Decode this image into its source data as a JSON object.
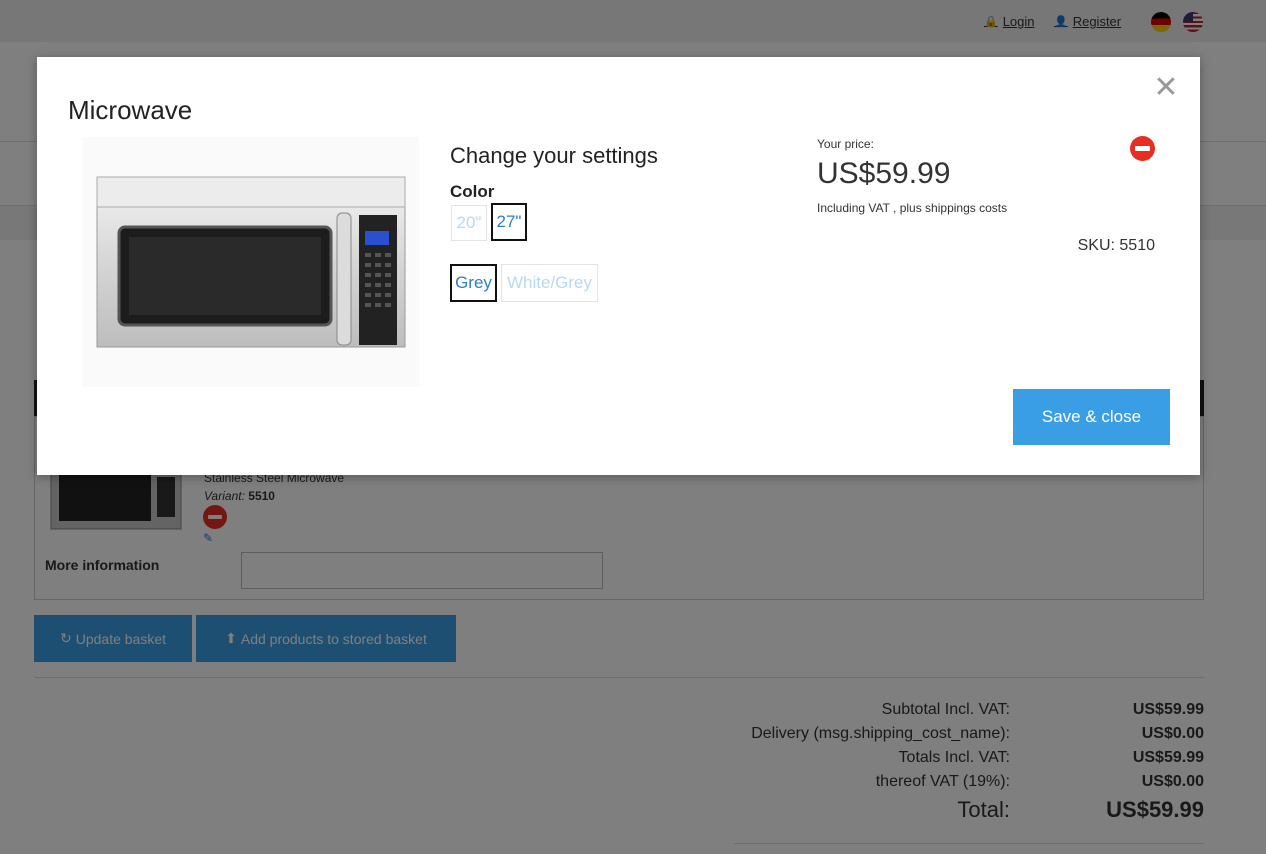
{
  "topbar": {
    "login_label": "Login",
    "register_label": "Register",
    "flags": [
      "german-flag-icon",
      "us-flag-icon"
    ]
  },
  "basket": {
    "item_title": "Stainless Steel Microwave",
    "variant_label": "Variant:",
    "variant_value": "5510",
    "more_info_label": "More information",
    "more_info_value": "",
    "update_button": "Update basket",
    "stored_button": "Add products to stored basket"
  },
  "totals": {
    "rows": [
      {
        "label": "Subtotal Incl. VAT:",
        "value": "US$59.99"
      },
      {
        "label": "Delivery (msg.shipping_cost_name):",
        "value": "US$0.00"
      },
      {
        "label": "Totals Incl. VAT:",
        "value": "US$59.99"
      },
      {
        "label": "thereof VAT (19%):",
        "value": "US$0.00"
      }
    ],
    "total_label": "Total:",
    "total_value": "US$59.99"
  },
  "modal": {
    "title": "Microwave",
    "close_icon": "close-icon",
    "settings_title": "Change your settings",
    "color_label": "Color",
    "size_options": [
      {
        "label": "20\"",
        "selected": false
      },
      {
        "label": "27\"",
        "selected": true
      }
    ],
    "color_options": [
      {
        "label": "Grey",
        "selected": true
      },
      {
        "label": "White/Grey",
        "selected": false
      }
    ],
    "price_label": "Your price:",
    "price_value": "US$59.99",
    "price_note": "Including VAT , plus shippings costs",
    "sku": "SKU: 5510",
    "save_button": "Save & close"
  },
  "colors": {
    "accent": "#3a9ee4",
    "remove": "#e62e24",
    "selected_text": "#2f7fc1",
    "disabled_text": "#b9d9f2"
  }
}
